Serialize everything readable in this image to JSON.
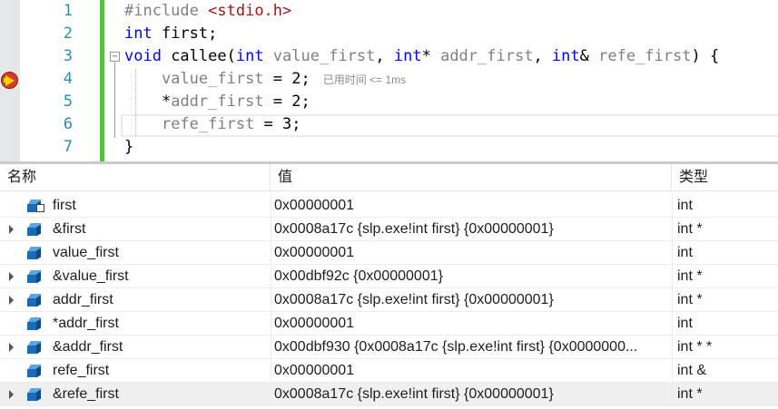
{
  "editor": {
    "line_numbers": [
      "1",
      "2",
      "3",
      "4",
      "5",
      "6",
      "7"
    ],
    "code": {
      "l1_kw": "#include",
      "l1_str": "<stdio.h>",
      "l2_kw": "int",
      "l2_rest": " first;",
      "l3_void": "void",
      "l3_fn": " callee(",
      "l3_int1": "int",
      "l3_p1": " value_first",
      "l3_c1": ", ",
      "l3_int2": "int",
      "l3_star": "* ",
      "l3_p2": "addr_first",
      "l3_c2": ", ",
      "l3_int3": "int",
      "l3_amp": "& ",
      "l3_p3": "refe_first",
      "l3_end": ") {",
      "l4_p": "value_first",
      "l4_rest": " = 2;",
      "l4_perf": "已用时间 <= 1ms",
      "l5_star": "*",
      "l5_p": "addr_first",
      "l5_rest": " = 2;",
      "l6_p": "refe_first",
      "l6_rest": " = 3;",
      "l7": "}"
    },
    "collapse_glyph": "−"
  },
  "watch": {
    "headers": {
      "name": "名称",
      "value": "值",
      "type": "类型"
    },
    "rows": [
      {
        "name": "first",
        "value": "0x00000001",
        "type": "int",
        "expandable": false,
        "icon": "static-variable-icon"
      },
      {
        "name": "&first",
        "value": "0x0008a17c {slp.exe!int first} {0x00000001}",
        "type": "int *",
        "expandable": true,
        "icon": "variable-icon"
      },
      {
        "name": "value_first",
        "value": "0x00000001",
        "type": "int",
        "expandable": false,
        "icon": "variable-icon"
      },
      {
        "name": "&value_first",
        "value": "0x00dbf92c {0x00000001}",
        "type": "int *",
        "expandable": true,
        "icon": "variable-icon"
      },
      {
        "name": "addr_first",
        "value": "0x0008a17c {slp.exe!int first} {0x00000001}",
        "type": "int *",
        "expandable": true,
        "icon": "variable-icon"
      },
      {
        "name": "*addr_first",
        "value": "0x00000001",
        "type": "int",
        "expandable": false,
        "icon": "variable-icon"
      },
      {
        "name": "&addr_first",
        "value": "0x00dbf930 {0x0008a17c {slp.exe!int first} {0x0000000...",
        "type": "int * *",
        "expandable": true,
        "icon": "variable-icon"
      },
      {
        "name": "refe_first",
        "value": "0x00000001",
        "type": "int &",
        "expandable": false,
        "icon": "variable-icon"
      },
      {
        "name": "&refe_first",
        "value": "0x0008a17c {slp.exe!int first} {0x00000001}",
        "type": "int *",
        "expandable": true,
        "icon": "variable-icon",
        "selected": true
      }
    ]
  },
  "colors": {
    "keyword": "#0000ff",
    "string": "#a31515",
    "line_number": "#2b91af",
    "change_bar": "#57c041",
    "breakpoint": "#d73a2b",
    "instruction_pointer": "#ffd200"
  }
}
